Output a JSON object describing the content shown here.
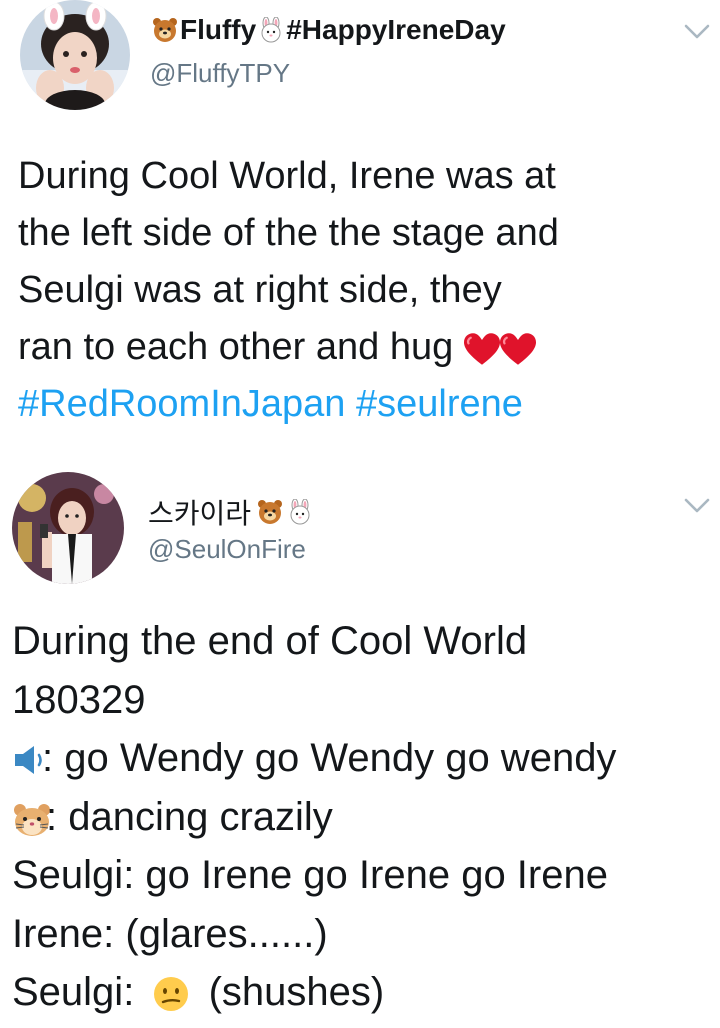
{
  "tweets": [
    {
      "display_name": "Fluffy",
      "display_name_suffix": "#HappyIreneDay",
      "handle": "@FluffyTPY",
      "text_lines": [
        "During Cool World, Irene was at",
        "the left side of the the stage and",
        "Seulgi was at right side, they",
        "ran to each other and hug"
      ],
      "hashtags": [
        "#RedRoomInJapan",
        "#seulrene"
      ],
      "icons": [
        "bear-face-icon",
        "rabbit-face-icon",
        "heart-icon",
        "heart-icon",
        "chevron-down-icon"
      ]
    },
    {
      "display_name": "스카이라",
      "handle": "@SeulOnFire",
      "text_lines": [
        "During the end of Cool World",
        "180329",
        ": go Wendy go Wendy go wendy",
        ": dancing crazily",
        "Seulgi: go Irene go Irene go Irene",
        "Irene: (glares......)",
        "Seulgi:",
        "(shushes)"
      ],
      "icons": [
        "bear-face-icon",
        "rabbit-face-icon",
        "speaker-icon",
        "hamster-face-icon",
        "confused-face-icon",
        "chevron-down-icon"
      ]
    }
  ],
  "colors": {
    "hashtag": "#1da1f2",
    "handle": "#657786",
    "heart": "#e0132b",
    "chevron": "#aab8c2"
  }
}
